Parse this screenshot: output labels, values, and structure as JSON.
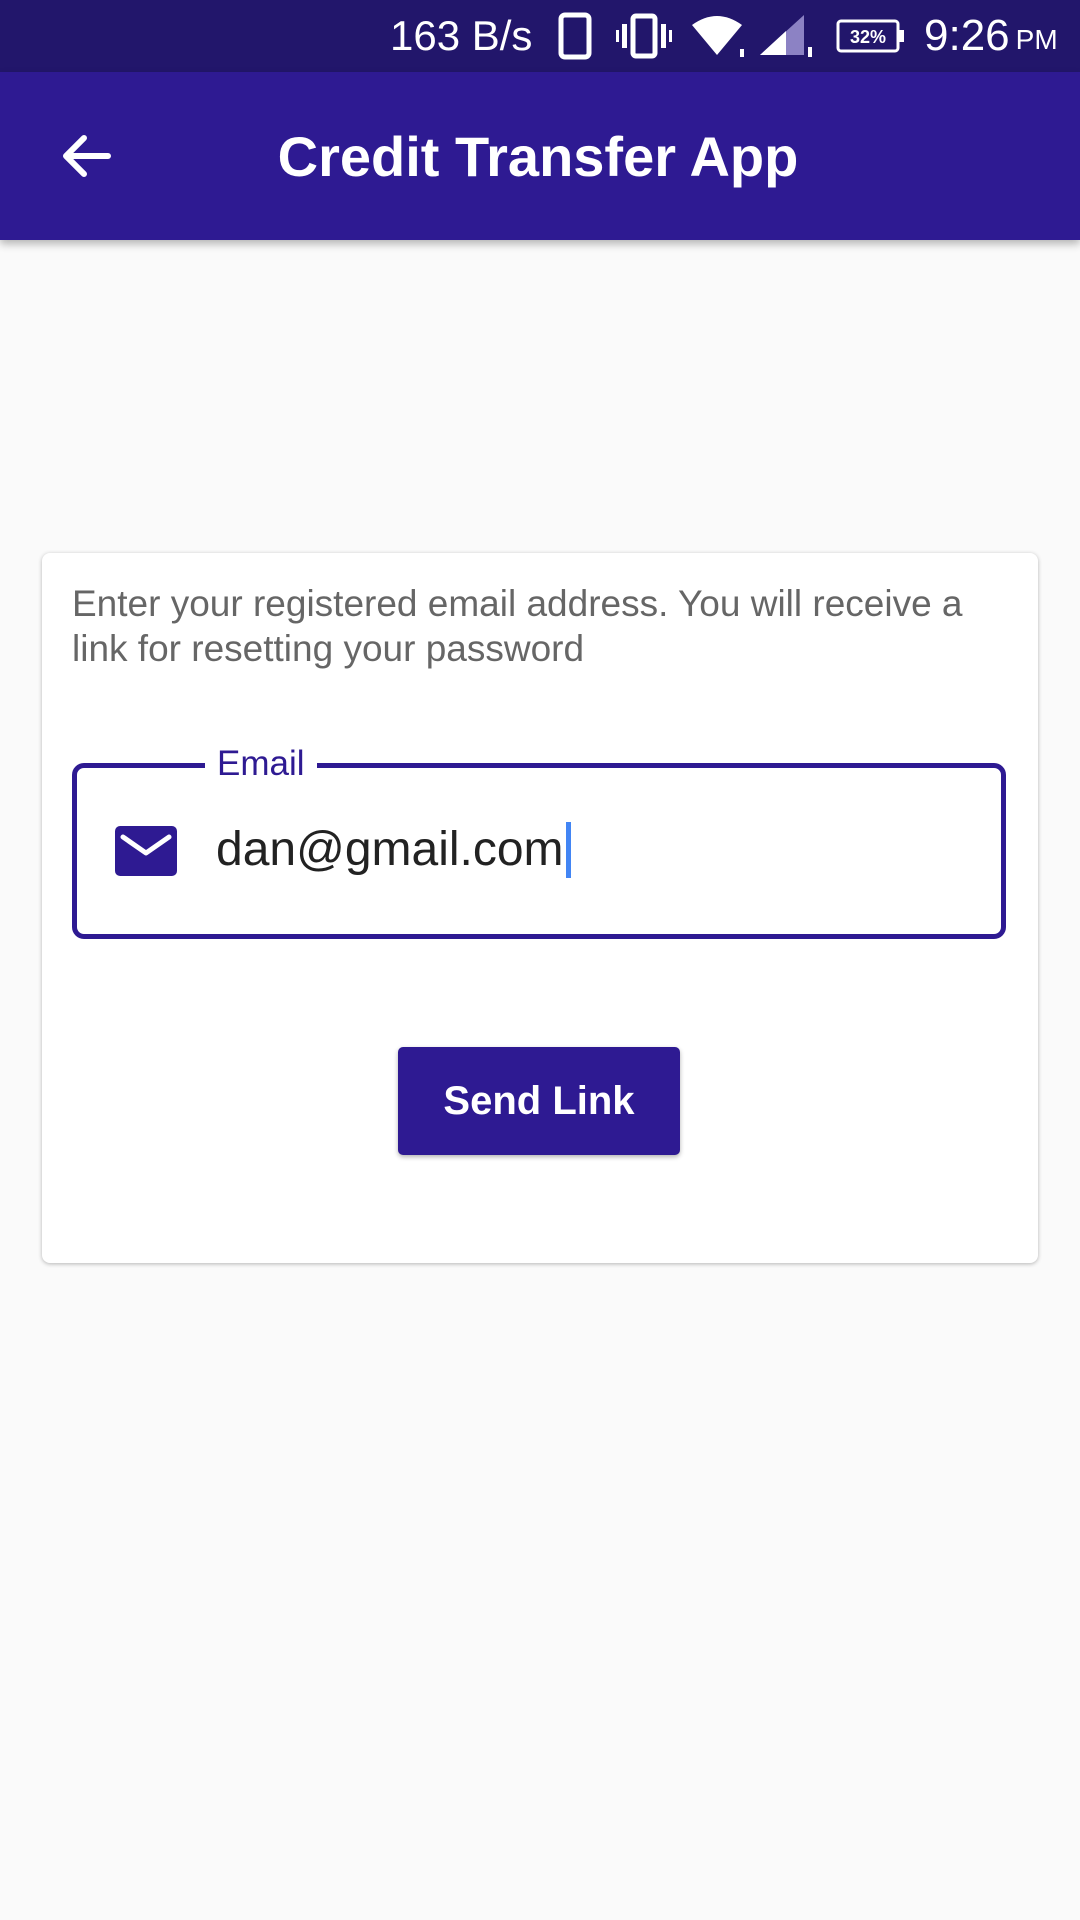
{
  "status_bar": {
    "network_speed": "163 B/s",
    "battery_percent": "32%",
    "time": "9:26",
    "ampm": "PM",
    "icons": [
      "phone-icon",
      "vibrate-icon",
      "wifi-icon",
      "signal-icon",
      "battery-icon"
    ]
  },
  "app_bar": {
    "title": "Credit Transfer App",
    "back_icon": "arrow-back-icon"
  },
  "reset_form": {
    "instructions": "Enter your registered email address. You will receive a link for resetting your password",
    "email_label": "Email",
    "email_value": "dan@gmail.com",
    "email_icon": "mail-icon",
    "send_button_label": "Send Link"
  },
  "colors": {
    "status_bar": "#22166b",
    "primary": "#2e1a92",
    "background": "#fafafa",
    "caret": "#4285f4"
  }
}
